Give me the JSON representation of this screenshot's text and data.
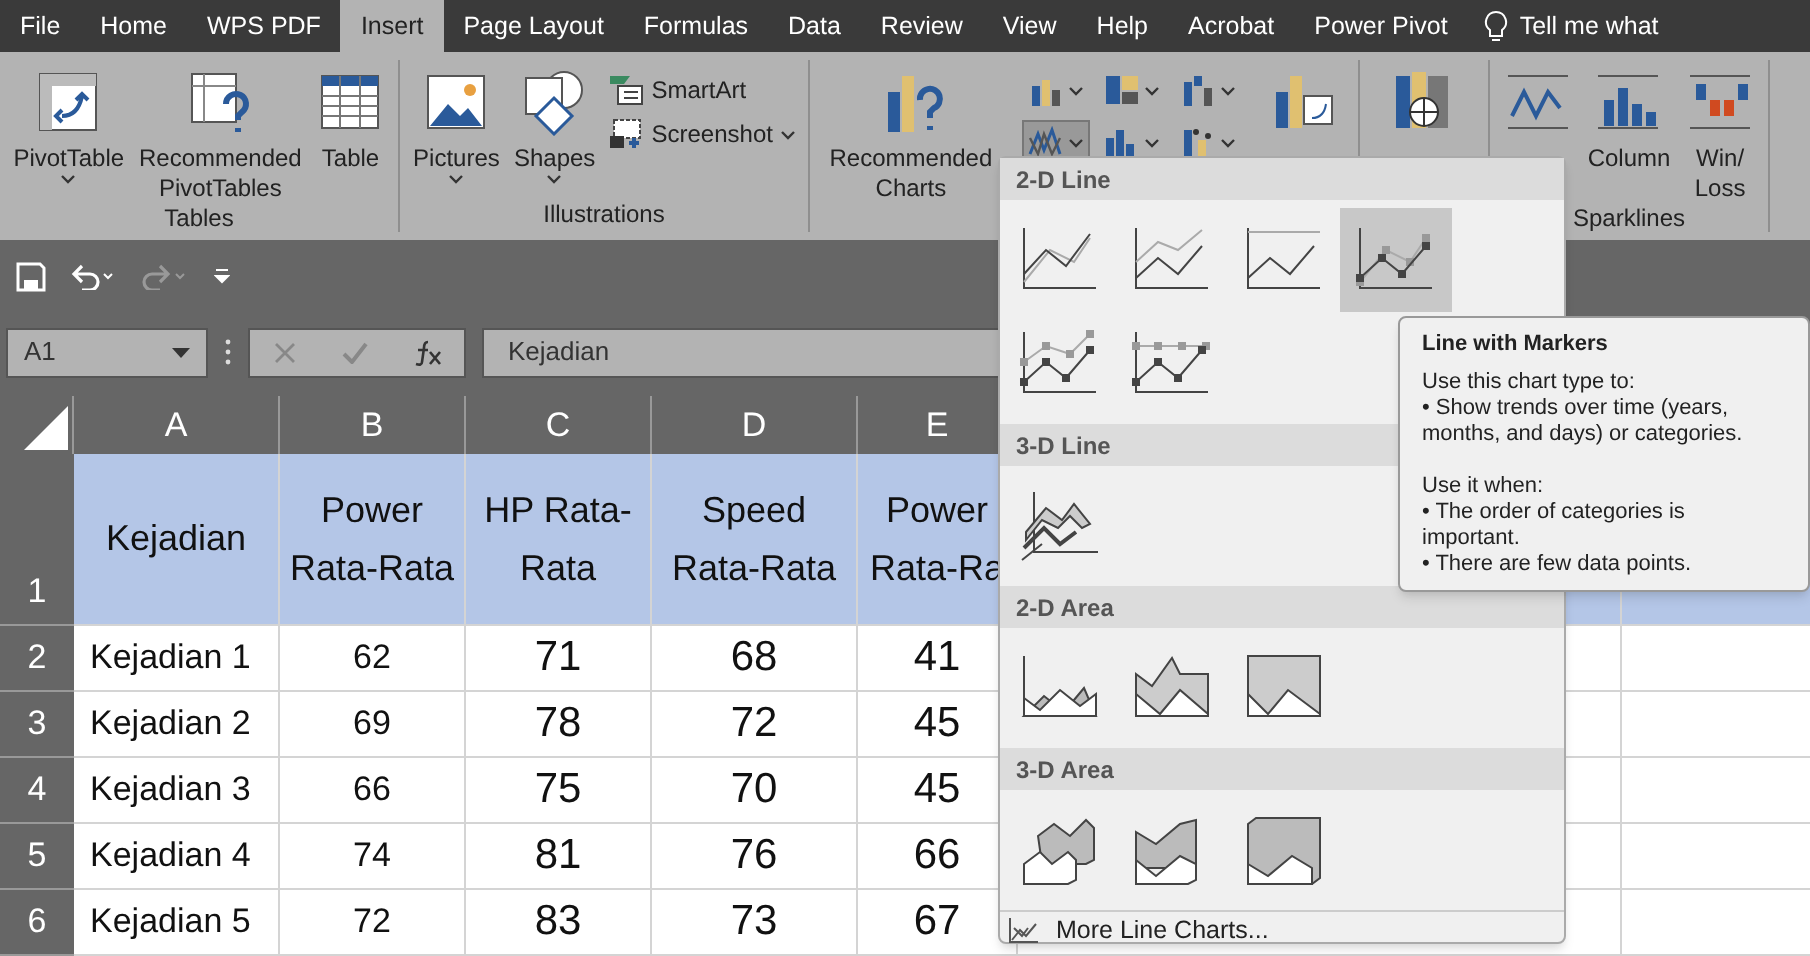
{
  "tabs": [
    {
      "label": "File",
      "selected": false
    },
    {
      "label": "Home",
      "selected": false
    },
    {
      "label": "WPS PDF",
      "selected": false
    },
    {
      "label": "Insert",
      "selected": true
    },
    {
      "label": "Page Layout",
      "selected": false
    },
    {
      "label": "Formulas",
      "selected": false
    },
    {
      "label": "Data",
      "selected": false
    },
    {
      "label": "Review",
      "selected": false
    },
    {
      "label": "View",
      "selected": false
    },
    {
      "label": "Help",
      "selected": false
    },
    {
      "label": "Acrobat",
      "selected": false
    },
    {
      "label": "Power Pivot",
      "selected": false
    }
  ],
  "tell_me": "Tell me what",
  "ribbon_groups": [
    {
      "label": "Tables",
      "items": [
        {
          "kind": "large",
          "label": "PivotTable",
          "dropdown": true
        },
        {
          "kind": "large",
          "label": "Recommended\nPivotTables",
          "dropdown": false
        },
        {
          "kind": "large",
          "label": "Table",
          "dropdown": false
        }
      ]
    },
    {
      "label": "Illustrations",
      "items": [
        {
          "kind": "large",
          "label": "Pictures",
          "dropdown": true
        },
        {
          "kind": "large",
          "label": "Shapes",
          "dropdown": true
        },
        {
          "kind": "small",
          "label": "SmartArt",
          "dropdown": false
        },
        {
          "kind": "small",
          "label": "Screenshot",
          "dropdown": true
        }
      ]
    },
    {
      "items": [
        {
          "kind": "large",
          "label": "Recommended\nCharts",
          "dropdown": false
        },
        {
          "kind": "gallery",
          "buttons": [
            {
              "selected": false
            },
            {
              "selected": false
            },
            {
              "selected": false
            },
            {
              "selected": true
            },
            {
              "selected": false
            },
            {
              "selected": false
            }
          ]
        },
        {
          "kind": "large",
          "dropdown": false
        }
      ]
    },
    {
      "items": [
        {
          "kind": "large",
          "dropdown": false
        }
      ]
    },
    {
      "label": "Sparklines",
      "items": [
        {
          "kind": "large",
          "dropdown": false
        },
        {
          "kind": "large",
          "label": "Column",
          "dropdown": false
        },
        {
          "kind": "large",
          "label": "Win/\nLoss",
          "dropdown": false
        }
      ]
    }
  ],
  "name_box": "A1",
  "formula": "Kejadian",
  "columns": [
    {
      "label": "A"
    },
    {
      "label": "B"
    },
    {
      "label": "C"
    },
    {
      "label": "D"
    },
    {
      "label": "E"
    }
  ],
  "rows": [
    {
      "number": "1",
      "cells": [
        "Kejadian",
        "Power Rata-Rata",
        "HP Rata-Rata",
        "Speed Rata-Rata",
        "Power Rata-Ra"
      ]
    },
    {
      "number": "2",
      "cells": [
        "Kejadian 1",
        "62",
        "71",
        "68",
        "41"
      ]
    },
    {
      "number": "3",
      "cells": [
        "Kejadian 2",
        "69",
        "78",
        "72",
        "45"
      ]
    },
    {
      "number": "4",
      "cells": [
        "Kejadian 3",
        "66",
        "75",
        "70",
        "45"
      ]
    },
    {
      "number": "5",
      "cells": [
        "Kejadian 4",
        "74",
        "81",
        "76",
        "66"
      ]
    },
    {
      "number": "6",
      "cells": [
        "Kejadian 5",
        "72",
        "83",
        "73",
        "67"
      ]
    }
  ],
  "dropdown": {
    "sections": [
      {
        "title": "2-D Line",
        "items": [
          {
            "selected": false
          },
          {
            "selected": false
          },
          {
            "selected": false
          },
          {
            "selected": true
          },
          {
            "selected": false
          },
          {
            "selected": false
          }
        ]
      },
      {
        "title": "3-D Line",
        "items": [
          {
            "selected": false
          }
        ]
      },
      {
        "title": "2-D Area",
        "items": [
          {
            "selected": false
          },
          {
            "selected": false
          },
          {
            "selected": false
          }
        ]
      },
      {
        "title": "3-D Area",
        "items": [
          {
            "selected": false
          },
          {
            "selected": false
          },
          {
            "selected": false
          }
        ]
      }
    ],
    "footer": "More Line Charts..."
  },
  "tooltip": {
    "title": "Line with Markers",
    "blocks": [
      {
        "heading": "Use this chart type to:",
        "bullets": [
          "• Show trends over time (years, months, and days) or categories."
        ]
      },
      {
        "heading": "Use it when:",
        "bullets": [
          "• The order of categories is important.",
          "• There are few data points."
        ]
      }
    ]
  }
}
